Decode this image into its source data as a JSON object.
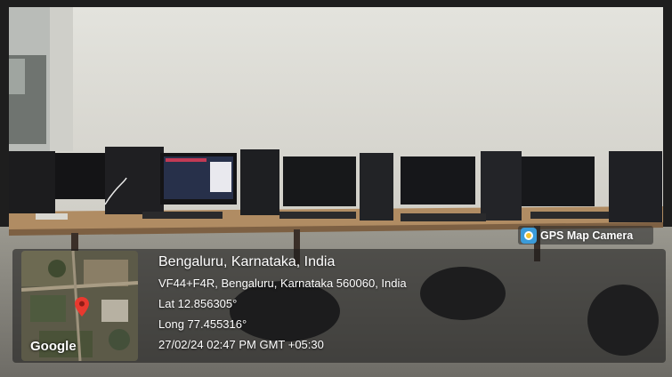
{
  "photo": {
    "scene_desc": "",
    "colors": {
      "wall": "#d9d8d2",
      "table": "#b08c63",
      "floor": "#8a8880",
      "accent": "#3b9bd9"
    }
  },
  "badge": {
    "label": "GPS Map Camera",
    "icon": "gps-map-camera-logo-icon"
  },
  "map": {
    "brand": "Google",
    "pin_icon": "map-pin-icon"
  },
  "location": {
    "title": "Bengaluru, Karnataka, India",
    "address": "VF44+F4R, Bengaluru, Karnataka 560060, India",
    "lat": "Lat 12.856305°",
    "long": "Long 77.455316°",
    "timestamp": "27/02/24 02:47 PM GMT +05:30"
  }
}
